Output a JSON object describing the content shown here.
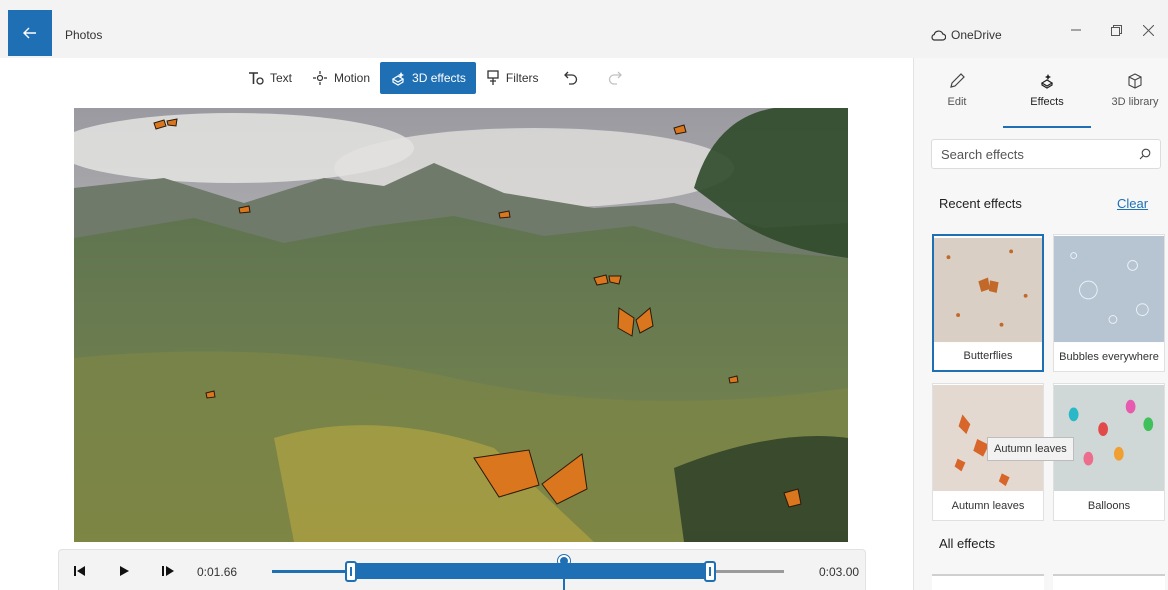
{
  "window": {
    "title": "Photos",
    "account": "OneDrive",
    "accent": "#1f6fb5"
  },
  "toolbar": {
    "items": [
      {
        "label": "Text",
        "icon": "text-icon"
      },
      {
        "label": "Motion",
        "icon": "motion-icon"
      },
      {
        "label": "3D effects",
        "icon": "3d-effects-icon",
        "active": true
      },
      {
        "label": "Filters",
        "icon": "filters-icon"
      }
    ],
    "undo_icon": "undo-icon",
    "redo_icon": "redo-icon"
  },
  "playback": {
    "current_time": "0:01.66",
    "end_time": "0:03.00",
    "selection_start_fraction": 0.155,
    "selection_end_fraction": 0.855,
    "playhead_fraction": 0.57
  },
  "panel": {
    "tabs": [
      {
        "label": "Edit",
        "icon": "pencil-icon"
      },
      {
        "label": "Effects",
        "icon": "effects-icon",
        "active": true
      },
      {
        "label": "3D library",
        "icon": "cube-icon"
      }
    ],
    "search_placeholder": "Search effects",
    "recent_heading": "Recent effects",
    "clear_label": "Clear",
    "recent_effects": [
      {
        "label": "Butterflies",
        "selected": true
      },
      {
        "label": "Bubbles everywhere"
      },
      {
        "label": "Autumn leaves"
      },
      {
        "label": "Balloons"
      }
    ],
    "tooltip": "Autumn leaves",
    "all_heading": "All effects"
  }
}
